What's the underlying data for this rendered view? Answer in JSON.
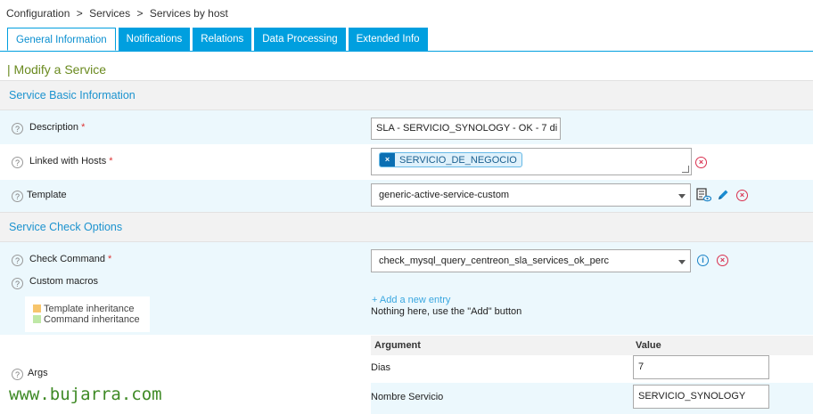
{
  "breadcrumb": {
    "items": [
      "Configuration",
      ">",
      "Services",
      ">",
      "Services by host"
    ]
  },
  "tabs": [
    {
      "label": "General Information",
      "active": true
    },
    {
      "label": "Notifications"
    },
    {
      "label": "Relations"
    },
    {
      "label": "Data Processing"
    },
    {
      "label": "Extended Info"
    }
  ],
  "page": {
    "title": "| Modify a Service"
  },
  "sections": {
    "basic": "Service Basic Information",
    "check": "Service Check Options"
  },
  "fields": {
    "description": {
      "label": "Description",
      "required": "*",
      "value": "SLA - SERVICIO_SYNOLOGY - OK - 7 di"
    },
    "linked_hosts": {
      "label": "Linked with Hosts",
      "required": "*",
      "tag": "SERVICIO_DE_NEGOCIO",
      "tag_remove": "×"
    },
    "template": {
      "label": "Template",
      "value": "generic-active-service-custom"
    },
    "check_command": {
      "label": "Check Command",
      "required": "*",
      "value": "check_mysql_query_centreon_sla_services_ok_perc"
    },
    "custom_macros": {
      "label": "Custom macros",
      "add_link": "+ Add a new entry",
      "empty": "Nothing here, use the \"Add\" button",
      "legend": [
        {
          "label": "Template inheritance",
          "color": "#f7c56c"
        },
        {
          "label": "Command inheritance",
          "color": "#bfe8a6"
        }
      ]
    },
    "args": {
      "label": "Args",
      "headers": {
        "argument": "Argument",
        "value": "Value"
      },
      "rows": [
        {
          "argument": "Dias",
          "value": "7"
        },
        {
          "argument": "Nombre Servicio",
          "value": "SERVICIO_SYNOLOGY"
        }
      ]
    }
  },
  "icons": {
    "help": "?",
    "remove": "×",
    "info": "i"
  },
  "watermark": "www.bujarra.com",
  "colors": {
    "tab": "#009fdf",
    "section": "#1c93cf",
    "title": "#6a8a1f",
    "row": "#ecf8fd",
    "danger": "#d9304f"
  }
}
